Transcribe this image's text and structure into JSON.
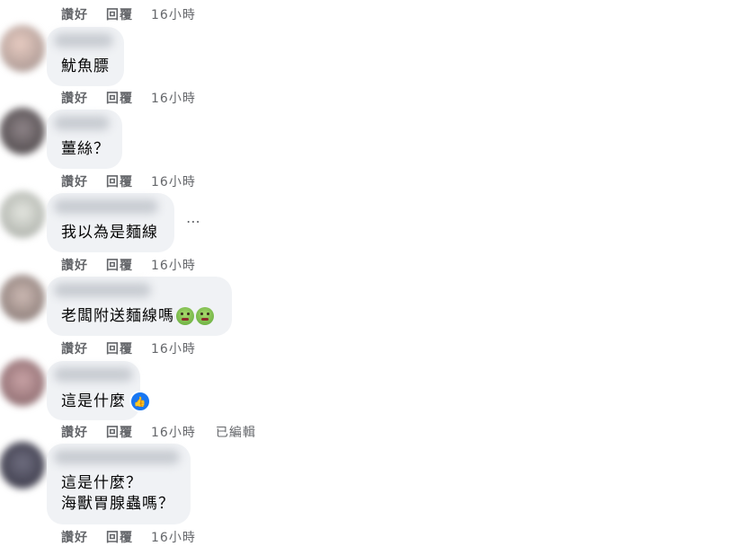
{
  "actions": {
    "like": "讚好",
    "reply": "回覆",
    "time": "16小時",
    "edited": "已編輯"
  },
  "more_icon": "⋯",
  "comments": [
    {
      "lines": [
        "魷魚膘"
      ]
    },
    {
      "lines": [
        "薑絲？"
      ]
    },
    {
      "lines": [
        "我以為是麵線"
      ]
    },
    {
      "lines": [
        "老闆附送麵線嗎"
      ],
      "emojis": [
        "nauseated-face-icon",
        "nauseated-face-icon"
      ]
    },
    {
      "lines": [
        "這是什麼"
      ],
      "reaction": "like-icon"
    },
    {
      "lines": [
        "這是什麼？",
        "海獸胃腺蟲嗎？"
      ]
    }
  ]
}
